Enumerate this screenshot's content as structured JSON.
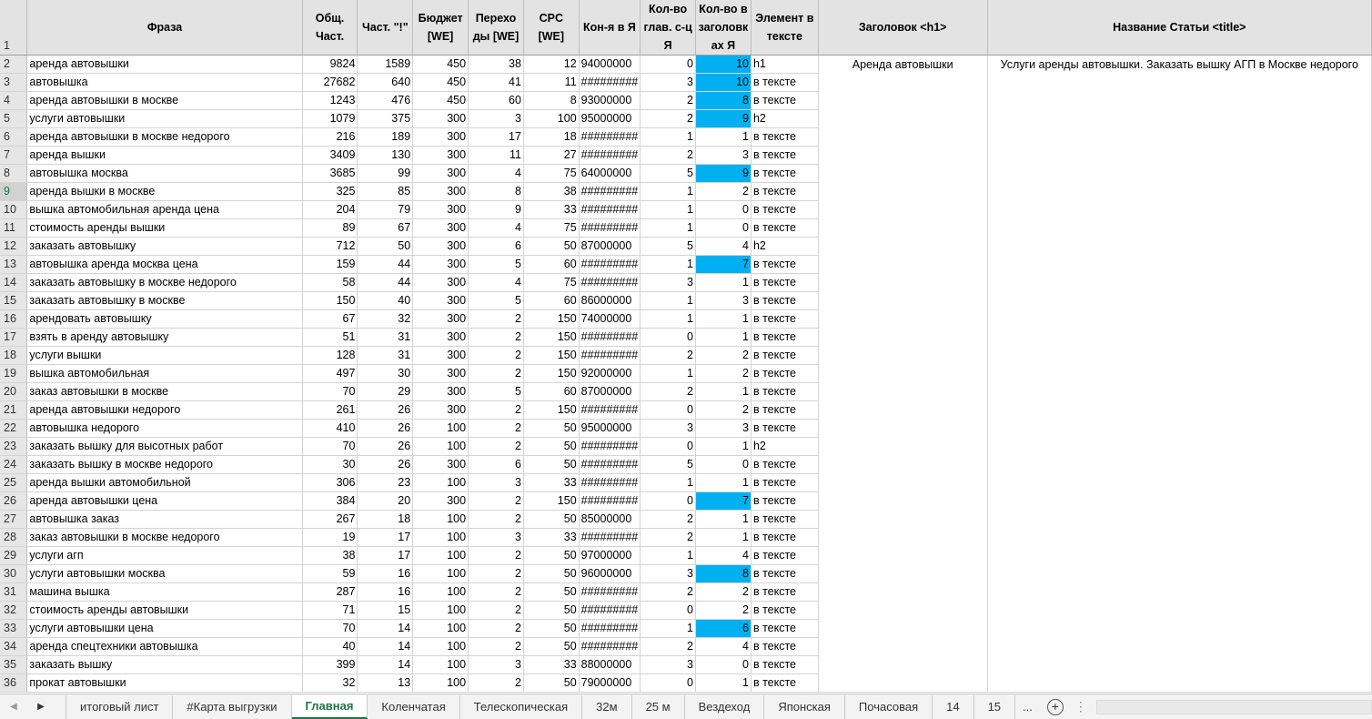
{
  "colors": {
    "highlight": "#00b0f0",
    "active_tab": "#217346"
  },
  "headers": {
    "row_num": "1",
    "phrase": "Фраза",
    "total_freq": "Общ. Част.",
    "exact_freq": "Част. \"!\"",
    "budget": "Бюджет [WE]",
    "clicks": "Перехо ды [WE]",
    "cpc": "CPC [WE]",
    "competition": "Кон-я в Я",
    "main_pages": "Кол-во глав. с-ц Я",
    "in_titles": "Кол-во в заголовк ах Я",
    "element": "Элемент в тексте",
    "h1": "Заголовок <h1>",
    "title": "Название Статьи <title>"
  },
  "h1_value": "Аренда автовышки",
  "title_value": "Услуги аренды автовышки. Заказать вышку АГП в Москве недорого",
  "rows": [
    {
      "n": "2",
      "phrase": "аренда автовышки",
      "f": "9824",
      "e": "1589",
      "b": "450",
      "c": "38",
      "cpc": "12",
      "k": "94000000",
      "m": "0",
      "t": "10",
      "hl": true,
      "el": "h1"
    },
    {
      "n": "3",
      "phrase": "автовышка",
      "f": "27682",
      "e": "640",
      "b": "450",
      "c": "41",
      "cpc": "11",
      "k": "#########",
      "m": "3",
      "t": "10",
      "hl": true,
      "el": "в тексте"
    },
    {
      "n": "4",
      "phrase": "аренда автовышки в москве",
      "f": "1243",
      "e": "476",
      "b": "450",
      "c": "60",
      "cpc": "8",
      "k": "93000000",
      "m": "2",
      "t": "8",
      "hl": true,
      "el": "в тексте"
    },
    {
      "n": "5",
      "phrase": "услуги автовышки",
      "f": "1079",
      "e": "375",
      "b": "300",
      "c": "3",
      "cpc": "100",
      "k": "95000000",
      "m": "2",
      "t": "9",
      "hl": true,
      "el": "h2"
    },
    {
      "n": "6",
      "phrase": "аренда автовышки в москве недорого",
      "f": "216",
      "e": "189",
      "b": "300",
      "c": "17",
      "cpc": "18",
      "k": "#########",
      "m": "1",
      "t": "1",
      "hl": false,
      "el": "в тексте"
    },
    {
      "n": "7",
      "phrase": "аренда вышки",
      "f": "3409",
      "e": "130",
      "b": "300",
      "c": "11",
      "cpc": "27",
      "k": "#########",
      "m": "2",
      "t": "3",
      "hl": false,
      "el": "в тексте"
    },
    {
      "n": "8",
      "phrase": "автовышка москва",
      "f": "3685",
      "e": "99",
      "b": "300",
      "c": "4",
      "cpc": "75",
      "k": "64000000",
      "m": "5",
      "t": "9",
      "hl": true,
      "el": "в тексте"
    },
    {
      "n": "9",
      "phrase": "аренда вышки в москве",
      "f": "325",
      "e": "85",
      "b": "300",
      "c": "8",
      "cpc": "38",
      "k": "#########",
      "m": "1",
      "t": "2",
      "hl": false,
      "el": "в тексте",
      "sel": true
    },
    {
      "n": "10",
      "phrase": "вышка автомобильная аренда цена",
      "f": "204",
      "e": "79",
      "b": "300",
      "c": "9",
      "cpc": "33",
      "k": "#########",
      "m": "1",
      "t": "0",
      "hl": false,
      "el": "в тексте"
    },
    {
      "n": "11",
      "phrase": "стоимость аренды вышки",
      "f": "89",
      "e": "67",
      "b": "300",
      "c": "4",
      "cpc": "75",
      "k": "#########",
      "m": "1",
      "t": "0",
      "hl": false,
      "el": "в тексте"
    },
    {
      "n": "12",
      "phrase": "заказать автовышку",
      "f": "712",
      "e": "50",
      "b": "300",
      "c": "6",
      "cpc": "50",
      "k": "87000000",
      "m": "5",
      "t": "4",
      "hl": false,
      "el": "h2"
    },
    {
      "n": "13",
      "phrase": "автовышка аренда москва цена",
      "f": "159",
      "e": "44",
      "b": "300",
      "c": "5",
      "cpc": "60",
      "k": "#########",
      "m": "1",
      "t": "7",
      "hl": true,
      "el": "в тексте"
    },
    {
      "n": "14",
      "phrase": "заказать автовышку в москве недорого",
      "f": "58",
      "e": "44",
      "b": "300",
      "c": "4",
      "cpc": "75",
      "k": "#########",
      "m": "3",
      "t": "1",
      "hl": false,
      "el": "в тексте"
    },
    {
      "n": "15",
      "phrase": "заказать автовышку в москве",
      "f": "150",
      "e": "40",
      "b": "300",
      "c": "5",
      "cpc": "60",
      "k": "86000000",
      "m": "1",
      "t": "3",
      "hl": false,
      "el": "в тексте"
    },
    {
      "n": "16",
      "phrase": "арендовать автовышку",
      "f": "67",
      "e": "32",
      "b": "300",
      "c": "2",
      "cpc": "150",
      "k": "74000000",
      "m": "1",
      "t": "1",
      "hl": false,
      "el": "в тексте"
    },
    {
      "n": "17",
      "phrase": "взять в аренду автовышку",
      "f": "51",
      "e": "31",
      "b": "300",
      "c": "2",
      "cpc": "150",
      "k": "#########",
      "m": "0",
      "t": "1",
      "hl": false,
      "el": "в тексте"
    },
    {
      "n": "18",
      "phrase": "услуги вышки",
      "f": "128",
      "e": "31",
      "b": "300",
      "c": "2",
      "cpc": "150",
      "k": "#########",
      "m": "2",
      "t": "2",
      "hl": false,
      "el": "в тексте"
    },
    {
      "n": "19",
      "phrase": "вышка автомобильная",
      "f": "497",
      "e": "30",
      "b": "300",
      "c": "2",
      "cpc": "150",
      "k": "92000000",
      "m": "1",
      "t": "2",
      "hl": false,
      "el": "в тексте"
    },
    {
      "n": "20",
      "phrase": "заказ автовышки в москве",
      "f": "70",
      "e": "29",
      "b": "300",
      "c": "5",
      "cpc": "60",
      "k": "87000000",
      "m": "2",
      "t": "1",
      "hl": false,
      "el": "в тексте"
    },
    {
      "n": "21",
      "phrase": "аренда автовышки недорого",
      "f": "261",
      "e": "26",
      "b": "300",
      "c": "2",
      "cpc": "150",
      "k": "#########",
      "m": "0",
      "t": "2",
      "hl": false,
      "el": "в тексте"
    },
    {
      "n": "22",
      "phrase": "автовышка недорого",
      "f": "410",
      "e": "26",
      "b": "100",
      "c": "2",
      "cpc": "50",
      "k": "95000000",
      "m": "3",
      "t": "3",
      "hl": false,
      "el": "в тексте"
    },
    {
      "n": "23",
      "phrase": "заказать вышку для высотных работ",
      "f": "70",
      "e": "26",
      "b": "100",
      "c": "2",
      "cpc": "50",
      "k": "#########",
      "m": "0",
      "t": "1",
      "hl": false,
      "el": "h2"
    },
    {
      "n": "24",
      "phrase": "заказать вышку в москве недорого",
      "f": "30",
      "e": "26",
      "b": "300",
      "c": "6",
      "cpc": "50",
      "k": "#########",
      "m": "5",
      "t": "0",
      "hl": false,
      "el": "в тексте"
    },
    {
      "n": "25",
      "phrase": "аренда вышки автомобильной",
      "f": "306",
      "e": "23",
      "b": "100",
      "c": "3",
      "cpc": "33",
      "k": "#########",
      "m": "1",
      "t": "1",
      "hl": false,
      "el": "в тексте"
    },
    {
      "n": "26",
      "phrase": "аренда автовышки цена",
      "f": "384",
      "e": "20",
      "b": "300",
      "c": "2",
      "cpc": "150",
      "k": "#########",
      "m": "0",
      "t": "7",
      "hl": true,
      "el": "в тексте"
    },
    {
      "n": "27",
      "phrase": "автовышка заказ",
      "f": "267",
      "e": "18",
      "b": "100",
      "c": "2",
      "cpc": "50",
      "k": "85000000",
      "m": "2",
      "t": "1",
      "hl": false,
      "el": "в тексте"
    },
    {
      "n": "28",
      "phrase": "заказ автовышки в москве недорого",
      "f": "19",
      "e": "17",
      "b": "100",
      "c": "3",
      "cpc": "33",
      "k": "#########",
      "m": "2",
      "t": "1",
      "hl": false,
      "el": "в тексте"
    },
    {
      "n": "29",
      "phrase": "услуги агп",
      "f": "38",
      "e": "17",
      "b": "100",
      "c": "2",
      "cpc": "50",
      "k": "97000000",
      "m": "1",
      "t": "4",
      "hl": false,
      "el": "в тексте"
    },
    {
      "n": "30",
      "phrase": "услуги автовышки москва",
      "f": "59",
      "e": "16",
      "b": "100",
      "c": "2",
      "cpc": "50",
      "k": "96000000",
      "m": "3",
      "t": "8",
      "hl": true,
      "el": "в тексте"
    },
    {
      "n": "31",
      "phrase": "машина вышка",
      "f": "287",
      "e": "16",
      "b": "100",
      "c": "2",
      "cpc": "50",
      "k": "#########",
      "m": "2",
      "t": "2",
      "hl": false,
      "el": "в тексте"
    },
    {
      "n": "32",
      "phrase": "стоимость аренды автовышки",
      "f": "71",
      "e": "15",
      "b": "100",
      "c": "2",
      "cpc": "50",
      "k": "#########",
      "m": "0",
      "t": "2",
      "hl": false,
      "el": "в тексте"
    },
    {
      "n": "33",
      "phrase": "услуги автовышки цена",
      "f": "70",
      "e": "14",
      "b": "100",
      "c": "2",
      "cpc": "50",
      "k": "#########",
      "m": "1",
      "t": "6",
      "hl": true,
      "el": "в тексте"
    },
    {
      "n": "34",
      "phrase": "аренда спецтехники автовышка",
      "f": "40",
      "e": "14",
      "b": "100",
      "c": "2",
      "cpc": "50",
      "k": "#########",
      "m": "2",
      "t": "4",
      "hl": false,
      "el": "в тексте"
    },
    {
      "n": "35",
      "phrase": "заказать вышку",
      "f": "399",
      "e": "14",
      "b": "100",
      "c": "3",
      "cpc": "33",
      "k": "88000000",
      "m": "3",
      "t": "0",
      "hl": false,
      "el": "в тексте"
    },
    {
      "n": "36",
      "phrase": "прокат автовышки",
      "f": "32",
      "e": "13",
      "b": "100",
      "c": "2",
      "cpc": "50",
      "k": "79000000",
      "m": "0",
      "t": "1",
      "hl": false,
      "el": "в тексте"
    }
  ],
  "tabs": [
    {
      "label": "итоговый лист",
      "active": false
    },
    {
      "label": "#Карта выгрузки",
      "active": false
    },
    {
      "label": "Главная",
      "active": true
    },
    {
      "label": "Коленчатая",
      "active": false
    },
    {
      "label": "Телескопическая",
      "active": false
    },
    {
      "label": "32м",
      "active": false
    },
    {
      "label": "25 м",
      "active": false
    },
    {
      "label": "Вездеход",
      "active": false
    },
    {
      "label": "Японская",
      "active": false
    },
    {
      "label": "Почасовая",
      "active": false
    },
    {
      "label": "14",
      "active": false
    },
    {
      "label": "15",
      "active": false
    }
  ],
  "tab_more": "...",
  "tab_add": "+",
  "tab_options": "⋮",
  "nav_prev": "◀",
  "nav_next": "▶"
}
